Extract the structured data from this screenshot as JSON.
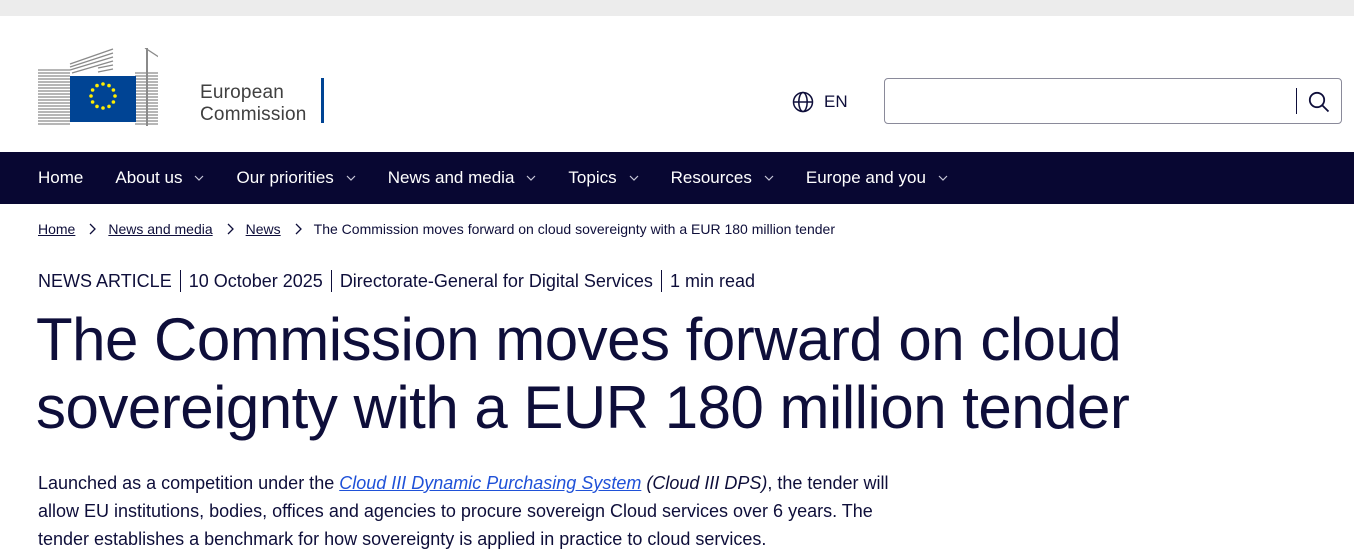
{
  "logo": {
    "line1": "European",
    "line2": "Commission",
    "eu_blue": "#004494",
    "star_color": "#ffed00"
  },
  "header": {
    "language": "EN",
    "search_placeholder": "",
    "language_icon": "globe-icon",
    "search_icon": "magnifier-icon"
  },
  "nav": {
    "background": "#080732",
    "items": [
      {
        "label": "Home",
        "has_dropdown": false
      },
      {
        "label": "About us",
        "has_dropdown": true
      },
      {
        "label": "Our priorities",
        "has_dropdown": true
      },
      {
        "label": "News and media",
        "has_dropdown": true
      },
      {
        "label": "Topics",
        "has_dropdown": true
      },
      {
        "label": "Resources",
        "has_dropdown": true
      },
      {
        "label": "Europe and you",
        "has_dropdown": true
      }
    ]
  },
  "breadcrumb": {
    "items": [
      "Home",
      "News and media",
      "News"
    ],
    "current": "The Commission moves forward on cloud sovereignty with a EUR 180 million tender"
  },
  "article": {
    "type": "NEWS ARTICLE",
    "date": "10 October 2025",
    "department": "Directorate-General for Digital Services",
    "read_time": "1 min read",
    "title_line1": "The Commission moves forward on cloud",
    "title_line2": "sovereignty with a EUR 180 million tender",
    "lead_pre": "Launched as a competition under the ",
    "lead_link": "Cloud III Dynamic Purchasing System",
    "lead_paren": "(Cloud III DPS)",
    "lead_line1_end": ", the tender will",
    "lead_line2": "allow EU institutions, bodies, offices and agencies to procure sovereign Cloud services over 6 years. The",
    "lead_line3": "tender establishes a benchmark for how sovereignty is applied in practice to cloud services.",
    "link_color": "#1f51d8"
  }
}
